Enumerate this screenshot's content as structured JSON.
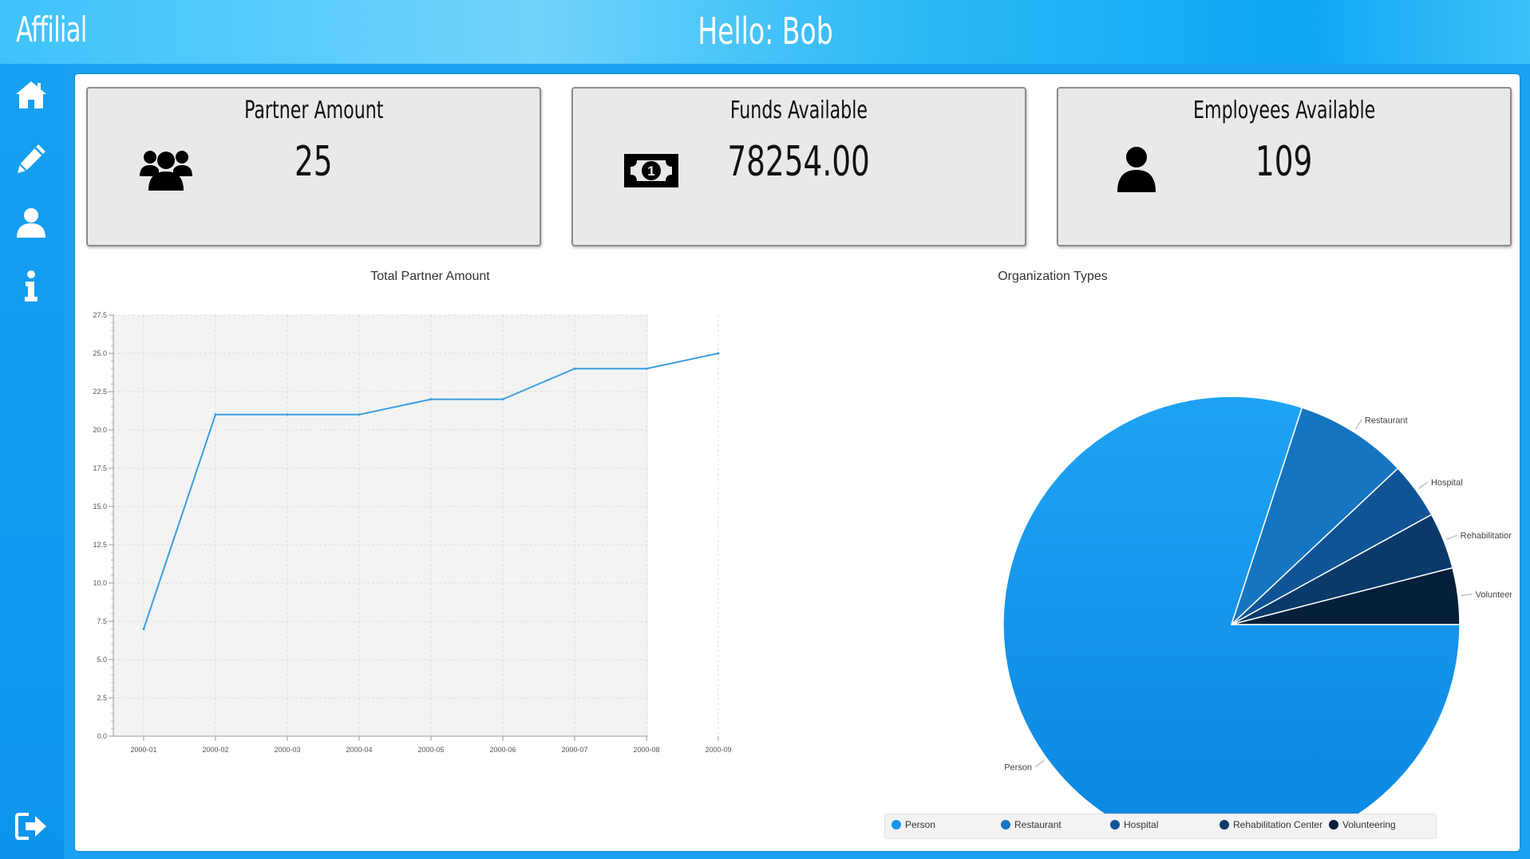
{
  "header": {
    "app_name": "Affilial",
    "greeting": "Hello: Bob"
  },
  "sidebar": {
    "items": [
      {
        "icon": "home-icon"
      },
      {
        "icon": "pencil-icon"
      },
      {
        "icon": "user-icon"
      },
      {
        "icon": "info-icon"
      }
    ],
    "logout_icon": "logout-icon"
  },
  "cards": {
    "partners": {
      "title": "Partner Amount",
      "value": "25",
      "icon": "users-icon"
    },
    "funds": {
      "title": "Funds Available",
      "value": "78254.00",
      "icon": "money-icon"
    },
    "employees": {
      "title": "Employees Available",
      "value": "109",
      "icon": "user-icon"
    }
  },
  "colors": {
    "accent": "#1aa3f0",
    "line": "#3a9ee0",
    "pie": [
      "#1596ea",
      "#1675c0",
      "#0f5596",
      "#0a3a69",
      "#061f3c"
    ]
  },
  "chart_data": [
    {
      "type": "line",
      "title": "Total Partner Amount",
      "x": [
        "2000-01",
        "2000-02",
        "2000-03",
        "2000-04",
        "2000-05",
        "2000-06",
        "2000-07",
        "2000-08",
        "2000-09"
      ],
      "series": [
        {
          "values": [
            7,
            21,
            21,
            21,
            22,
            22,
            24,
            24,
            25
          ]
        }
      ],
      "ylim": [
        0,
        27.5
      ],
      "yticks": [
        "0.0",
        "2.5",
        "5.0",
        "7.5",
        "10.0",
        "12.5",
        "15.0",
        "17.5",
        "20.0",
        "22.5",
        "25.0",
        "27.5"
      ],
      "grid": true
    },
    {
      "type": "pie",
      "title": "Organization Types",
      "categories": [
        "Person",
        "Restaurant",
        "Hospital",
        "Rehabilitation Center",
        "Volunteering"
      ],
      "values": [
        20,
        2,
        1,
        1,
        1
      ],
      "legend": "bottom"
    }
  ]
}
